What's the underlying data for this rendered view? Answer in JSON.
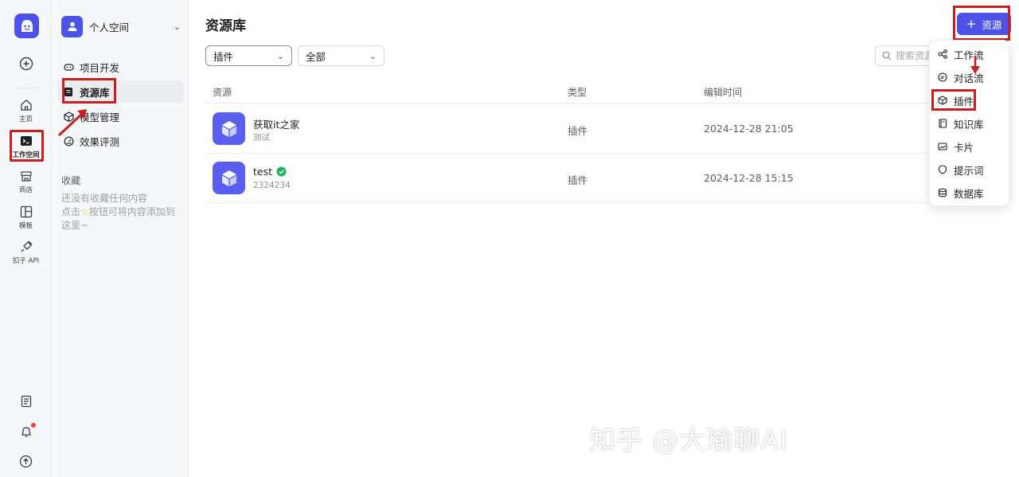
{
  "rail": {
    "items": [
      {
        "label": "主页"
      },
      {
        "label": "工作空间"
      },
      {
        "label": "商店"
      },
      {
        "label": "模板"
      },
      {
        "label": "扣子 API"
      }
    ]
  },
  "sidebar": {
    "space_name": "个人空间",
    "nav": [
      {
        "label": "项目开发"
      },
      {
        "label": "资源库"
      },
      {
        "label": "模型管理"
      },
      {
        "label": "效果评测"
      }
    ],
    "favorites_title": "收藏",
    "favorites_empty_1": "还没有收藏任何内容",
    "favorites_empty_2a": "点击",
    "favorites_empty_2b": "按钮可将内容添加到这里~"
  },
  "main": {
    "title": "资源库",
    "add_button": "资源",
    "filters": {
      "type": "插件",
      "status": "全部"
    },
    "search_placeholder": "搜索资源",
    "columns": [
      "资源",
      "类型",
      "编辑时间"
    ],
    "rows": [
      {
        "name": "获取it之家",
        "desc": "测试",
        "type": "插件",
        "time": "2024-12-28 21:05",
        "verified": false
      },
      {
        "name": "test",
        "desc": "2324234",
        "type": "插件",
        "time": "2024-12-28 15:15",
        "verified": true
      }
    ]
  },
  "menu": {
    "items": [
      {
        "label": "工作流",
        "icon": "workflow-icon"
      },
      {
        "label": "对话流",
        "icon": "chatflow-icon"
      },
      {
        "label": "插件",
        "icon": "plugin-icon"
      },
      {
        "label": "知识库",
        "icon": "knowledge-icon"
      },
      {
        "label": "卡片",
        "icon": "card-icon"
      },
      {
        "label": "提示词",
        "icon": "prompt-icon"
      },
      {
        "label": "数据库",
        "icon": "database-icon"
      }
    ]
  },
  "watermark": "知乎 @大瑜聊AI",
  "colors": {
    "accent": "#4d53e8",
    "annotation": "#c8201f"
  }
}
